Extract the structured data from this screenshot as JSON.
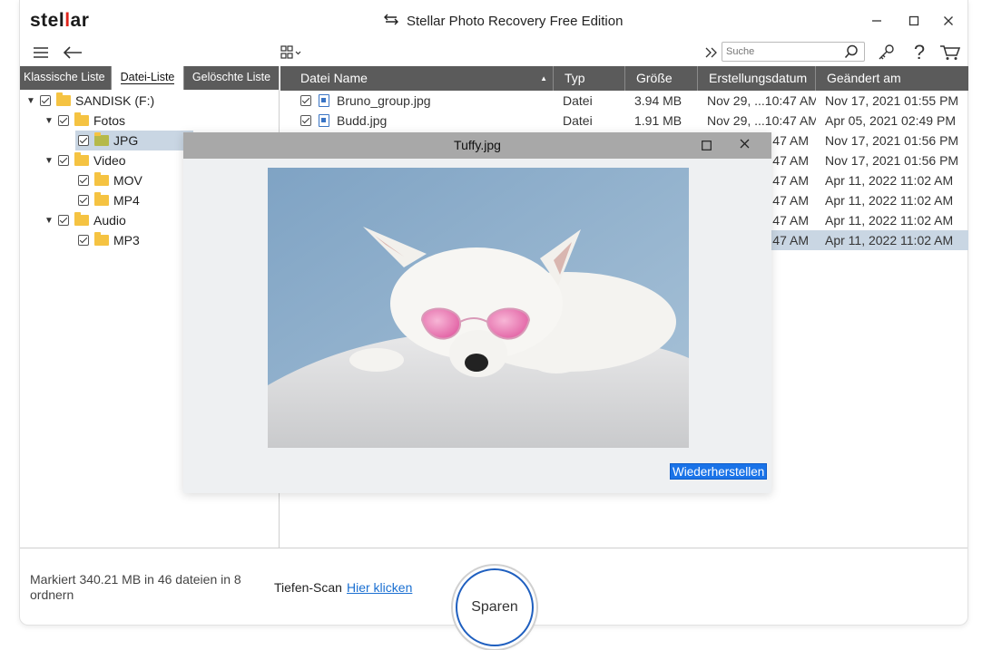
{
  "app": {
    "logo_text": "stellar",
    "title": "Stellar Photo Recovery Free Edition"
  },
  "toolbar": {
    "search_placeholder": "Suche",
    "icons": [
      "menu-icon",
      "back-arrow-icon",
      "grid-view-icon",
      "expand-chevron-icon",
      "search-icon",
      "key-icon",
      "help-icon",
      "cart-icon"
    ]
  },
  "left_tabs": [
    "Klassische Liste",
    "Datei-Liste",
    "Gelöschte Liste"
  ],
  "tree": [
    {
      "label": "SANDISK (F:)"
    },
    {
      "label": "Fotos"
    },
    {
      "label": "JPG"
    },
    {
      "label": "Video"
    },
    {
      "label": "MOV"
    },
    {
      "label": "MP4"
    },
    {
      "label": "Audio"
    },
    {
      "label": "MP3"
    }
  ],
  "table": {
    "columns": [
      "Datei Name",
      "Typ",
      "Größe",
      "Erstellungsdatum",
      "Geändert am"
    ],
    "rows": [
      {
        "name": "Bruno_group.jpg",
        "type": "Datei",
        "size": "3.94 MB",
        "created": "Nov 29, ...10:47 AM",
        "modified": "Nov 17, 2021 01:55 PM"
      },
      {
        "name": "Budd.jpg",
        "type": "Datei",
        "size": "1.91 MB",
        "created": "Nov 29, ...10:47 AM",
        "modified": "Apr 05, 2021 02:49 PM"
      },
      {
        "name": "",
        "type": "",
        "size": "",
        "created": "47 AM",
        "modified": "Nov 17, 2021 01:56 PM"
      },
      {
        "name": "",
        "type": "",
        "size": "",
        "created": "47 AM",
        "modified": "Nov 17, 2021 01:56 PM"
      },
      {
        "name": "",
        "type": "",
        "size": "",
        "created": "47 AM",
        "modified": "Apr 11, 2022 11:02 AM"
      },
      {
        "name": "",
        "type": "",
        "size": "",
        "created": "47 AM",
        "modified": "Apr 11, 2022 11:02 AM"
      },
      {
        "name": "",
        "type": "",
        "size": "",
        "created": "47 AM",
        "modified": "Apr 11, 2022 11:02 AM"
      },
      {
        "name": "",
        "type": "",
        "size": "",
        "created": "47 AM",
        "modified": "Apr 11, 2022 11:02 AM"
      }
    ]
  },
  "preview": {
    "title": "Tuffy.jpg",
    "restore_label": "Wiederherstellen"
  },
  "footer": {
    "status": "Markiert 340.21 MB in 46 dateien in 8 ordnern",
    "deep_scan_label": "Tiefen-Scan",
    "deep_scan_link": "Hier klicken",
    "save_label": "Sparen"
  },
  "colors": {
    "accent": "#1a73e8",
    "header_bg": "#5b5b5b",
    "selection": "#c9d6e3",
    "logo_accent": "#e0241b"
  }
}
